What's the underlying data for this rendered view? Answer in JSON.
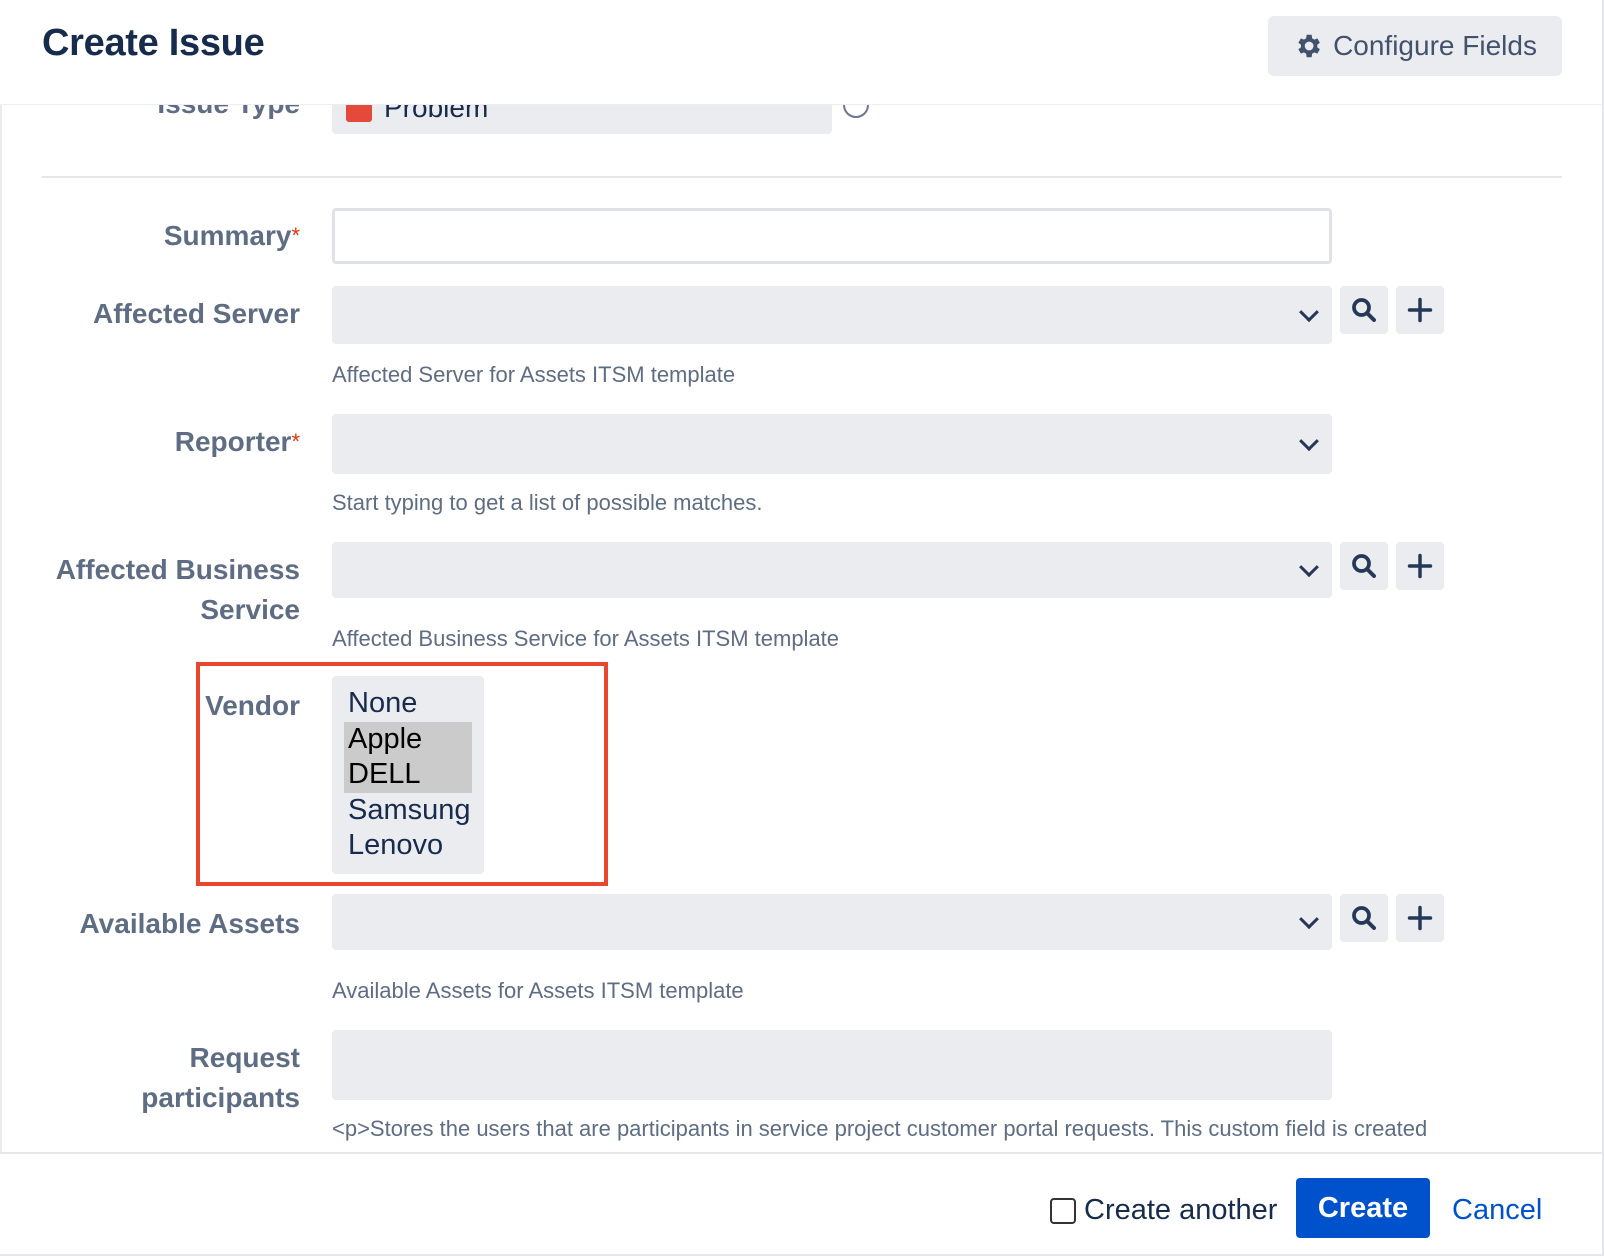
{
  "dialog": {
    "title": "Create Issue",
    "configure_fields_label": "Configure Fields"
  },
  "issue_type": {
    "label": "Issue Type",
    "value": "Problem"
  },
  "fields": {
    "summary": {
      "label": "Summary",
      "required_mark": "*",
      "value": ""
    },
    "affected_server": {
      "label": "Affected Server",
      "value": "",
      "description": "Affected Server for Assets ITSM template"
    },
    "reporter": {
      "label": "Reporter",
      "required_mark": "*",
      "value": "",
      "description": "Start typing to get a list of possible matches."
    },
    "affected_business_service": {
      "label_line1": "Affected Business",
      "label_line2": "Service",
      "value": "",
      "description": "Affected Business Service for Assets ITSM template"
    },
    "vendor": {
      "label": "Vendor",
      "options": [
        "None",
        "Apple",
        "DELL",
        "Samsung",
        "Lenovo"
      ],
      "selected": [
        "Apple",
        "DELL"
      ]
    },
    "available_assets": {
      "label": "Available Assets",
      "value": "",
      "description": "Available Assets for Assets ITSM template"
    },
    "request_participants": {
      "label_line1": "Request",
      "label_line2": "participants",
      "value": "",
      "description": "<p>Stores the users that are participants in service project customer portal requests. This custom field is created"
    }
  },
  "footer": {
    "create_another_label": "Create another",
    "create_another_checked": false,
    "create_label": "Create",
    "cancel_label": "Cancel"
  },
  "colors": {
    "primary": "#0052cc",
    "required": "#de350b",
    "highlight_border": "#e8462f",
    "field_bg": "#ebecf0"
  },
  "icons": [
    "gear-icon",
    "search-icon",
    "plus-icon",
    "chevron-down-icon",
    "help-icon",
    "problem-issue-type-icon"
  ]
}
